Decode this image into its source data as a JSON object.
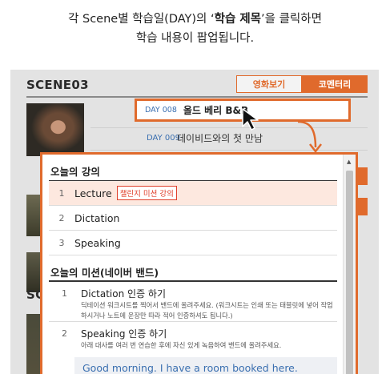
{
  "caption": {
    "line1_prefix": "각 Scene별 학습일(DAY)의 ‘",
    "line1_bold": "학습 제목",
    "line1_suffix": "’을 클릭하면",
    "line2": "학습 내용이 팝업됩니다."
  },
  "background": {
    "scene_title": "SCENE03",
    "scene_title_2": "SCENE",
    "tabs": [
      "영화보기",
      "코멘터리"
    ],
    "days": [
      {
        "day": "DAY 008",
        "title": "올드 베리 B&B"
      },
      {
        "day": "DAY 009",
        "title": "데이비드와의 첫 만남"
      }
    ]
  },
  "popup": {
    "lecture_section_title": "오늘의 강의",
    "lectures": [
      {
        "num": "1",
        "label": "Lecture",
        "badge": "챌린지 미션 강의"
      },
      {
        "num": "2",
        "label": "Dictation"
      },
      {
        "num": "3",
        "label": "Speaking"
      }
    ],
    "mission_section_title": "오늘의 미션(네이버 밴드)",
    "missions": [
      {
        "num": "1",
        "title": "Dictation 인증 하기",
        "desc": "딕테이션 워크시트를 찍어서 밴드에 올려주세요. (워크시트는 인쇄 또는 태블릿에 넣어 작업하시거나 노트에 운장만 따라 적어 인증하셔도 됩니다.)"
      },
      {
        "num": "2",
        "title": "Speaking 인증 하기",
        "desc": "아래 대사를 여러 번 연습한 후에 자신 있게 녹음하여 밴드에 올려주세요."
      }
    ],
    "quote": "Good morning. I have a room booked here."
  },
  "colors": {
    "accent": "#e06a2c",
    "link_blue": "#3a6fb0",
    "highlight_row": "#fde8df"
  },
  "icons": [
    "mouse-pointer-icon",
    "curved-arrow-icon",
    "scroll-up-icon"
  ]
}
